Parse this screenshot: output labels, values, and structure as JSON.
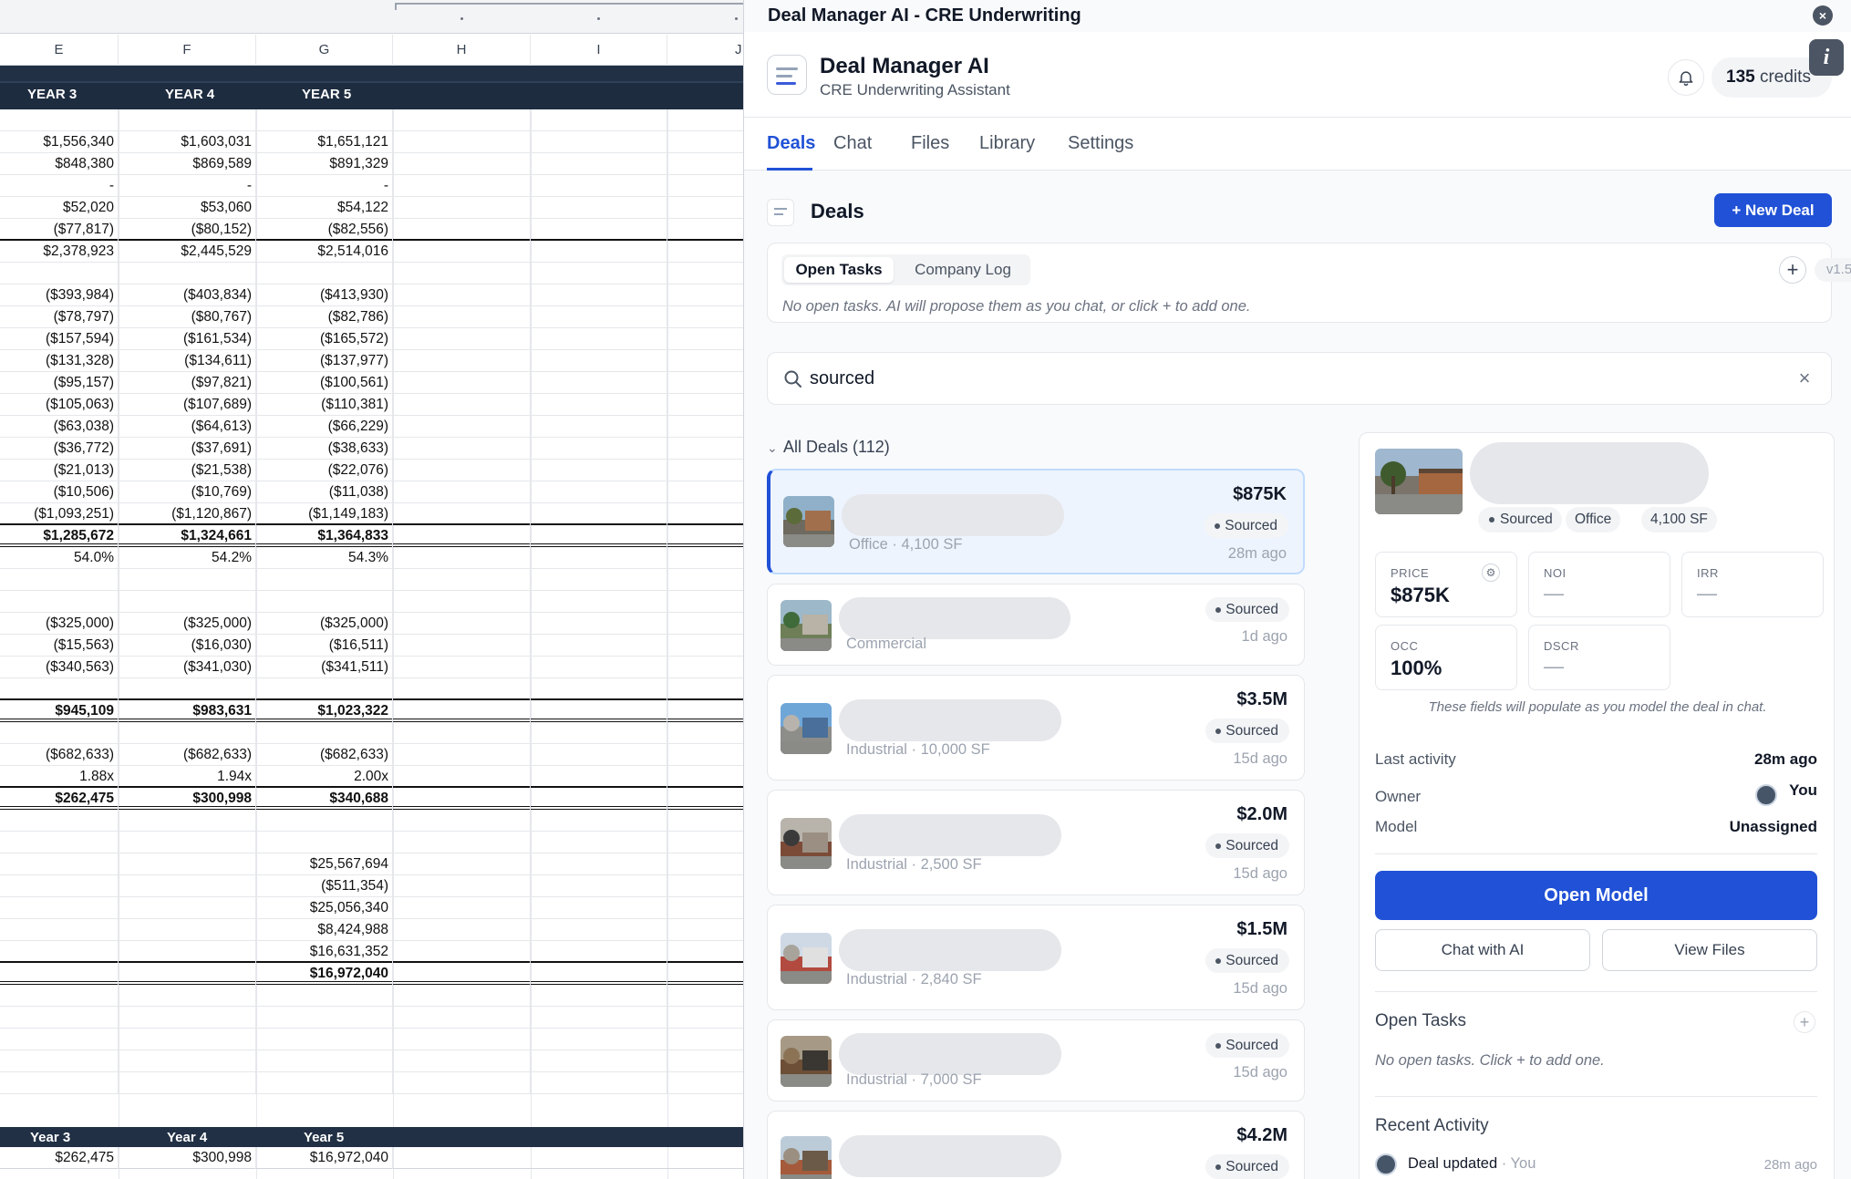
{
  "sheet": {
    "columns": [
      "E",
      "F",
      "G",
      "H",
      "I",
      "J"
    ],
    "header_labels": [
      "YEAR 3",
      "YEAR 4",
      "YEAR 5"
    ],
    "rows": [
      {
        "vals": [
          "",
          "",
          ""
        ],
        "style": ""
      },
      {
        "vals": [
          "$1,556,340",
          "$1,603,031",
          "$1,651,121"
        ],
        "style": ""
      },
      {
        "vals": [
          "$848,380",
          "$869,589",
          "$891,329"
        ],
        "style": ""
      },
      {
        "vals": [
          "-",
          "-",
          "-"
        ],
        "style": ""
      },
      {
        "vals": [
          "$52,020",
          "$53,060",
          "$54,122"
        ],
        "style": ""
      },
      {
        "vals": [
          "($77,817)",
          "($80,152)",
          "($82,556)"
        ],
        "style": "total"
      },
      {
        "vals": [
          "$2,378,923",
          "$2,445,529",
          "$2,514,016"
        ],
        "style": ""
      },
      {
        "vals": [
          "",
          "",
          ""
        ],
        "style": ""
      },
      {
        "vals": [
          "($393,984)",
          "($403,834)",
          "($413,930)"
        ],
        "style": ""
      },
      {
        "vals": [
          "($78,797)",
          "($80,767)",
          "($82,786)"
        ],
        "style": ""
      },
      {
        "vals": [
          "($157,594)",
          "($161,534)",
          "($165,572)"
        ],
        "style": ""
      },
      {
        "vals": [
          "($131,328)",
          "($134,611)",
          "($137,977)"
        ],
        "style": ""
      },
      {
        "vals": [
          "($95,157)",
          "($97,821)",
          "($100,561)"
        ],
        "style": ""
      },
      {
        "vals": [
          "($105,063)",
          "($107,689)",
          "($110,381)"
        ],
        "style": ""
      },
      {
        "vals": [
          "($63,038)",
          "($64,613)",
          "($66,229)"
        ],
        "style": ""
      },
      {
        "vals": [
          "($36,772)",
          "($37,691)",
          "($38,633)"
        ],
        "style": ""
      },
      {
        "vals": [
          "($21,013)",
          "($21,538)",
          "($22,076)"
        ],
        "style": ""
      },
      {
        "vals": [
          "($10,506)",
          "($10,769)",
          "($11,038)"
        ],
        "style": ""
      },
      {
        "vals": [
          "($1,093,251)",
          "($1,120,867)",
          "($1,149,183)"
        ],
        "style": "total"
      },
      {
        "vals": [
          "$1,285,672",
          "$1,324,661",
          "$1,364,833"
        ],
        "style": "dbl bold"
      },
      {
        "vals": [
          "54.0%",
          "54.2%",
          "54.3%"
        ],
        "style": ""
      },
      {
        "vals": [
          "",
          "",
          ""
        ],
        "style": ""
      },
      {
        "vals": [
          "",
          "",
          ""
        ],
        "style": ""
      },
      {
        "vals": [
          "($325,000)",
          "($325,000)",
          "($325,000)"
        ],
        "style": ""
      },
      {
        "vals": [
          "($15,563)",
          "($16,030)",
          "($16,511)"
        ],
        "style": ""
      },
      {
        "vals": [
          "($340,563)",
          "($341,030)",
          "($341,511)"
        ],
        "style": ""
      },
      {
        "vals": [
          "",
          "",
          ""
        ],
        "style": "total"
      },
      {
        "vals": [
          "$945,109",
          "$983,631",
          "$1,023,322"
        ],
        "style": "dbl bold"
      },
      {
        "vals": [
          "",
          "",
          ""
        ],
        "style": ""
      },
      {
        "vals": [
          "($682,633)",
          "($682,633)",
          "($682,633)"
        ],
        "style": ""
      },
      {
        "vals": [
          "1.88x",
          "1.94x",
          "2.00x"
        ],
        "style": "total"
      },
      {
        "vals": [
          "$262,475",
          "$300,998",
          "$340,688"
        ],
        "style": "dbl bold"
      },
      {
        "vals": [
          "",
          "",
          ""
        ],
        "style": ""
      },
      {
        "vals": [
          "",
          "",
          ""
        ],
        "style": ""
      },
      {
        "vals": [
          "",
          "",
          "$25,567,694"
        ],
        "style": ""
      },
      {
        "vals": [
          "",
          "",
          "($511,354)"
        ],
        "style": ""
      },
      {
        "vals": [
          "",
          "",
          "$25,056,340"
        ],
        "style": ""
      },
      {
        "vals": [
          "",
          "",
          "$8,424,988"
        ],
        "style": ""
      },
      {
        "vals": [
          "",
          "",
          "$16,631,352"
        ],
        "style": "total"
      },
      {
        "vals": [
          "",
          "",
          "$16,972,040"
        ],
        "style": "dbl bold"
      },
      {
        "vals": [
          "",
          "",
          ""
        ],
        "style": ""
      },
      {
        "vals": [
          "",
          "",
          ""
        ],
        "style": ""
      },
      {
        "vals": [
          "",
          "",
          ""
        ],
        "style": ""
      },
      {
        "vals": [
          "",
          "",
          ""
        ],
        "style": ""
      },
      {
        "vals": [
          "",
          "",
          ""
        ],
        "style": ""
      }
    ],
    "footer_labels": [
      "Year 3",
      "Year 4",
      "Year 5"
    ],
    "footer_values": [
      "$262,475",
      "$300,998",
      "$16,972,040"
    ]
  },
  "panel": {
    "window_title": "Deal Manager AI - CRE Underwriting",
    "app_title": "Deal Manager AI",
    "app_subtitle": "CRE Underwriting Assistant",
    "credits_count": "135",
    "credits_label": "credits",
    "info_glyph": "i",
    "close_glyph": "×",
    "bell_icon": "bell-icon",
    "tabs": [
      {
        "label": "Deals",
        "active": true
      },
      {
        "label": "Chat",
        "active": false
      },
      {
        "label": "Files",
        "active": false
      },
      {
        "label": "Library",
        "active": false
      },
      {
        "label": "Settings",
        "active": false
      }
    ],
    "deals_title": "Deals",
    "new_deal_label": "+ New Deal",
    "tasks": {
      "tab_open": "Open Tasks",
      "tab_log": "Company Log",
      "plus": "+",
      "version": "v1.5",
      "empty_msg": "No open tasks. AI will propose them as you chat, or click + to add one."
    },
    "search": {
      "value": "sourced",
      "clear": "×"
    },
    "all_deals_label": "All Deals (112)",
    "deals": [
      {
        "price": "$875K",
        "status": "Sourced",
        "subtitle": "Office · 4,100 SF",
        "ago": "28m ago",
        "selected": true
      },
      {
        "price": "",
        "status": "Sourced",
        "subtitle": "Commercial",
        "ago": "1d ago",
        "selected": false
      },
      {
        "price": "$3.5M",
        "status": "Sourced",
        "subtitle": "Industrial · 10,000 SF",
        "ago": "15d ago",
        "selected": false
      },
      {
        "price": "$2.0M",
        "status": "Sourced",
        "subtitle": "Industrial · 2,500 SF",
        "ago": "15d ago",
        "selected": false
      },
      {
        "price": "$1.5M",
        "status": "Sourced",
        "subtitle": "Industrial · 2,840 SF",
        "ago": "15d ago",
        "selected": false
      },
      {
        "price": "",
        "status": "Sourced",
        "subtitle": "Industrial · 7,000 SF",
        "ago": "15d ago",
        "selected": false
      },
      {
        "price": "$4.2M",
        "status": "Sourced",
        "subtitle": "",
        "ago": "",
        "selected": false
      }
    ],
    "detail": {
      "chips": [
        "Sourced",
        "Office",
        "4,100 SF"
      ],
      "metrics": {
        "price_label": "PRICE",
        "price_value": "$875K",
        "noi_label": "NOI",
        "noi_value": "—",
        "irr_label": "IRR",
        "irr_value": "—",
        "occ_label": "OCC",
        "occ_value": "100%",
        "dscr_label": "DSCR",
        "dscr_value": "—"
      },
      "note": "These fields will populate as you model the deal in chat.",
      "last_activity_label": "Last activity",
      "last_activity_value": "28m ago",
      "owner_label": "Owner",
      "owner_value": "You",
      "model_label": "Model",
      "model_value": "Unassigned",
      "open_model": "Open Model",
      "chat_ai": "Chat with AI",
      "view_files": "View Files",
      "open_tasks_title": "Open Tasks",
      "open_tasks_plus": "+",
      "open_tasks_msg": "No open tasks. Click + to add one.",
      "recent_title": "Recent Activity",
      "recent_event": "Deal updated",
      "recent_who": "· You",
      "recent_ago": "28m ago"
    },
    "colors": {
      "accent": "#2051d6",
      "sheet_header": "#213044"
    }
  }
}
